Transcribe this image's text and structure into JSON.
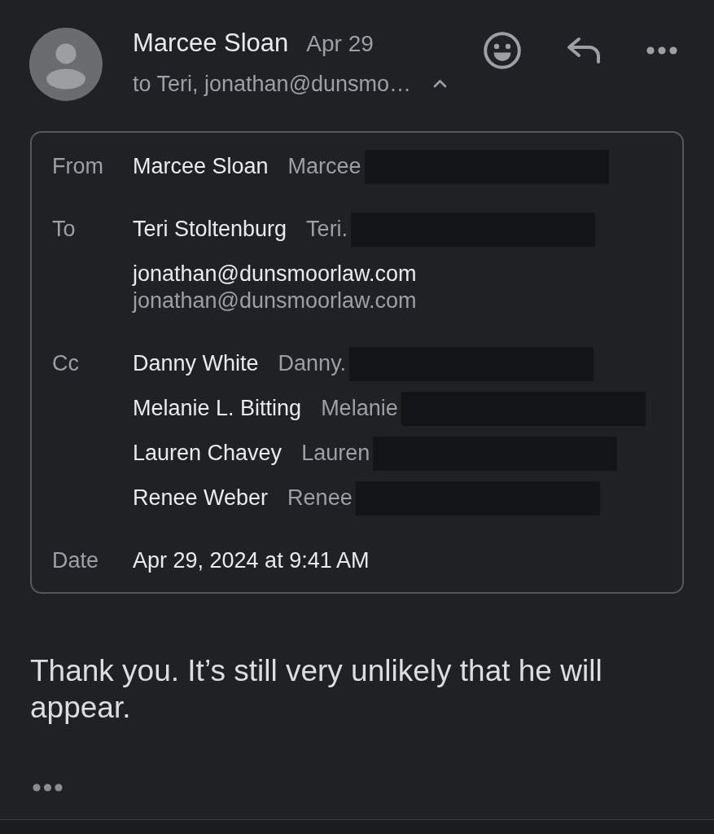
{
  "message": {
    "sender": "Marcee Sloan",
    "date": "Apr 29",
    "recipients_summary": "to Teri, jonathan@dunsmo…",
    "details_expanded": true
  },
  "details": [
    {
      "label": "From",
      "entries": [
        {
          "kind": "inline",
          "name": "Marcee Sloan",
          "address": "Marcee",
          "redacted": true
        }
      ]
    },
    {
      "label": "To",
      "entries": [
        {
          "kind": "inline",
          "name": "Teri Stoltenburg",
          "address": "Teri.",
          "redacted": true
        },
        {
          "kind": "stacked",
          "name": "jonathan@dunsmoorlaw.com",
          "address": "jonathan@dunsmoorlaw.com",
          "redacted": false
        }
      ]
    },
    {
      "label": "Cc",
      "entries": [
        {
          "kind": "inline",
          "name": "Danny White",
          "address": "Danny.",
          "redacted": true
        },
        {
          "kind": "inline",
          "name": "Melanie L. Bitting",
          "address": "Melanie",
          "redacted": true
        },
        {
          "kind": "inline",
          "name": "Lauren Chavey",
          "address": "Lauren",
          "redacted": true
        },
        {
          "kind": "inline",
          "name": "Renee Weber",
          "address": "Renee",
          "redacted": true
        }
      ]
    },
    {
      "label": "Date",
      "entries": [
        {
          "kind": "plain",
          "text": "Apr 29, 2024 at 9:41 AM"
        }
      ]
    }
  ],
  "body": {
    "paragraphs": [
      "Thank you. It’s still very unlikely that he will appear."
    ],
    "trimmed_content": true
  }
}
